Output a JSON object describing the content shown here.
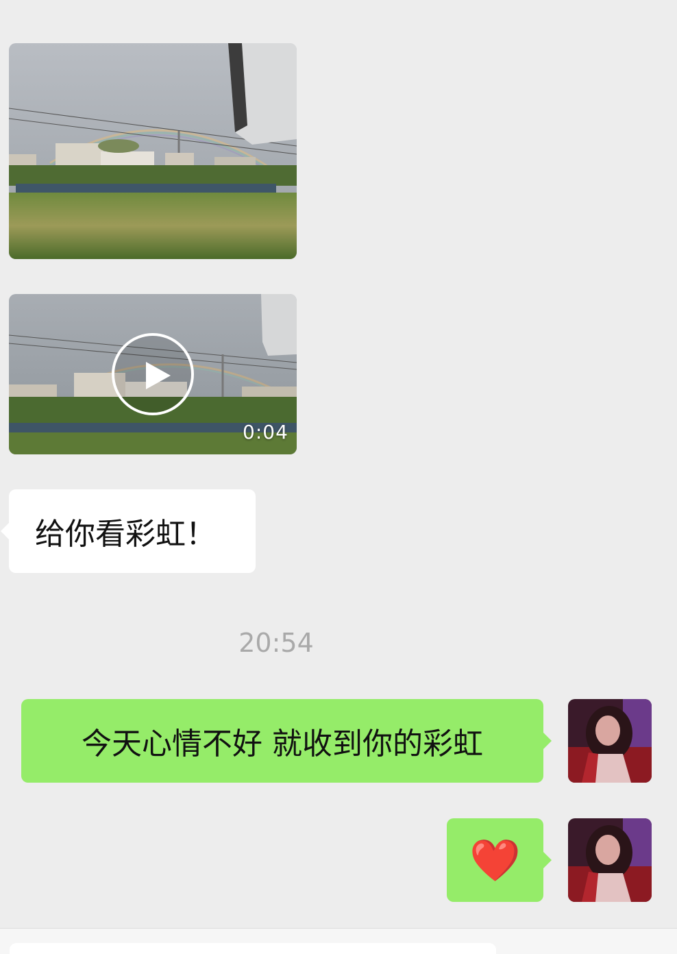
{
  "messages": {
    "video": {
      "duration": "0:04"
    },
    "received_text": "给你看彩虹！",
    "timestamp": "20:54",
    "sent_text_1": "今天心情不好 就收到你的彩虹",
    "sent_emoji": "❤️"
  },
  "icons": {
    "play": "play-icon"
  },
  "colors": {
    "background": "#ededed",
    "sent_bubble": "#95ec69",
    "received_bubble": "#ffffff",
    "timestamp_text": "#a9a9a9"
  }
}
